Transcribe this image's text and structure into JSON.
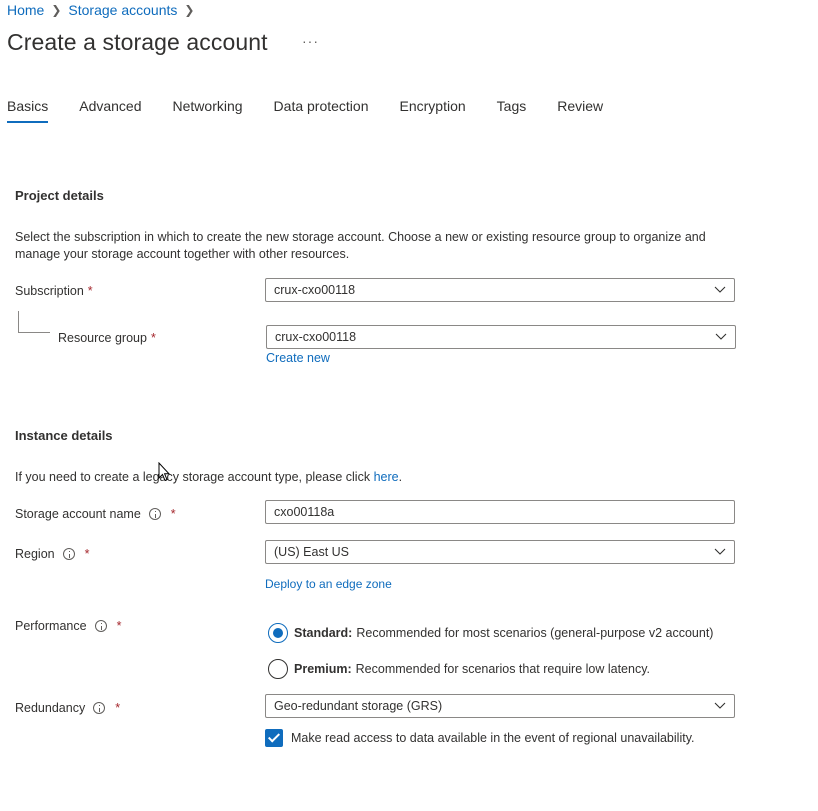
{
  "breadcrumb": {
    "home": "Home",
    "storage_accounts": "Storage accounts"
  },
  "page": {
    "title": "Create a storage account",
    "more": "···"
  },
  "tabs": [
    {
      "label": "Basics",
      "active": true
    },
    {
      "label": "Advanced"
    },
    {
      "label": "Networking"
    },
    {
      "label": "Data protection"
    },
    {
      "label": "Encryption"
    },
    {
      "label": "Tags"
    },
    {
      "label": "Review"
    }
  ],
  "project": {
    "title": "Project details",
    "description_line1": "Select the subscription in which to create the new storage account. Choose a new or existing resource group to organize and",
    "description_line2": "manage your storage account together with other resources.",
    "subscription_label": "Subscription",
    "subscription_value": "crux-cxo00118",
    "resource_group_label": "Resource group",
    "resource_group_value": "crux-cxo00118",
    "create_new": "Create new"
  },
  "instance": {
    "title": "Instance details",
    "legacy_text": "If you need to create a legacy storage account type, please click",
    "legacy_link": "here",
    "legacy_period": ".",
    "name_label": "Storage account name",
    "name_value": "cxo00118a",
    "region_label": "Region",
    "region_value": "(US) East US",
    "edge_zone_link": "Deploy to an edge zone",
    "performance_label": "Performance",
    "standard_label": "Standard:",
    "standard_desc": "Recommended for most scenarios (general-purpose v2 account)",
    "premium_label": "Premium:",
    "premium_desc": "Recommended for scenarios that require low latency.",
    "redundancy_label": "Redundancy",
    "redundancy_value": "Geo-redundant storage (GRS)",
    "read_access_label": "Make read access to data available in the event of regional unavailability."
  },
  "required_marker": "*",
  "colors": {
    "accent": "#0f6cbd",
    "required": "#a4262c",
    "text": "#323130",
    "border": "#8a8886"
  },
  "icons": {
    "chevron": "chevron-down-icon",
    "info": "info-icon",
    "breadcrumb_sep": "chevron-right-icon"
  }
}
